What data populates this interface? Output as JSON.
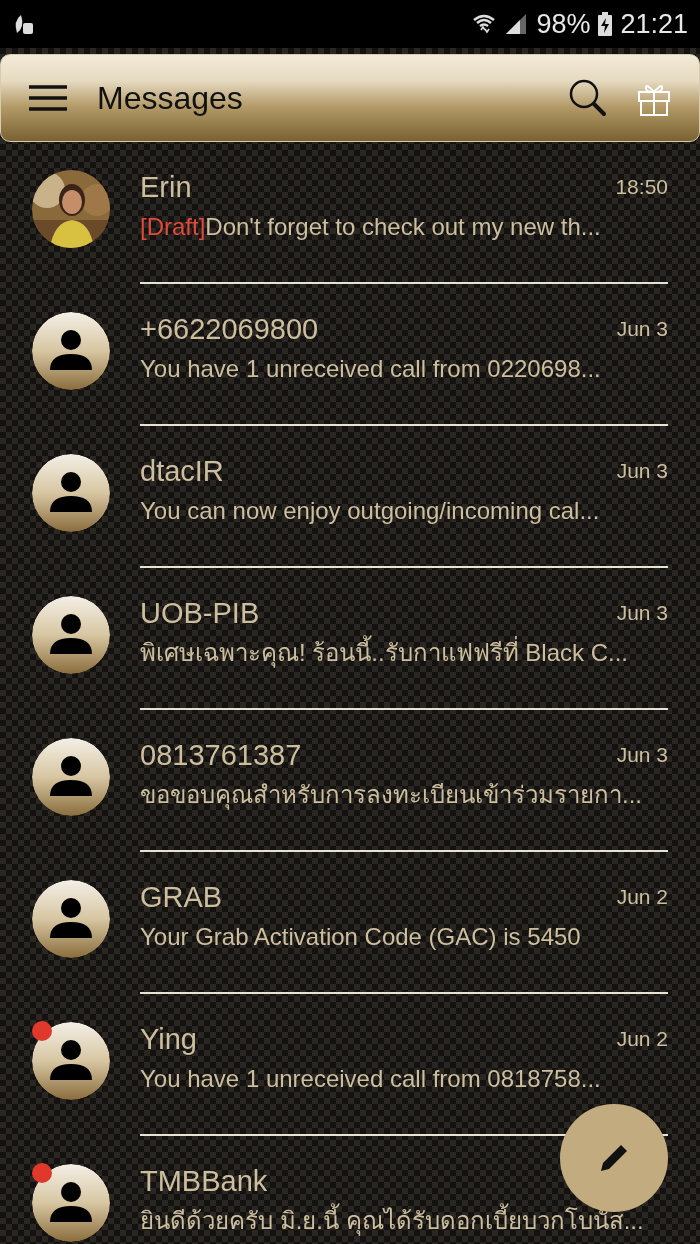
{
  "status_bar": {
    "battery": "98%",
    "time": "21:21"
  },
  "toolbar": {
    "title": "Messages"
  },
  "conversations": [
    {
      "name": "Erin",
      "date": "18:50",
      "draft_label": "[Draft]",
      "preview": "Don't forget to check out my new th...",
      "unread": false
    },
    {
      "name": "+6622069800",
      "date": "Jun 3",
      "preview": "You have 1 unreceived call from 0220698...",
      "kind": "contact",
      "unread": false
    },
    {
      "name": "dtacIR",
      "date": "Jun 3",
      "preview": "You can now enjoy outgoing/incoming cal...",
      "kind": "contact",
      "unread": false
    },
    {
      "name": "UOB-PIB",
      "date": "Jun 3",
      "preview": "พิเศษเฉพาะคุณ! ร้อนนี้..รับกาแฟฟรีที่ Black C...",
      "kind": "contact",
      "unread": false
    },
    {
      "name": "0813761387",
      "date": "Jun 3",
      "preview": "ขอขอบคุณสำหรับการลงทะเบียนเข้าร่วมรายกา...",
      "kind": "contact",
      "unread": false
    },
    {
      "name": "GRAB",
      "date": "Jun 2",
      "preview": "Your Grab Activation Code (GAC) is 5450",
      "kind": "contact",
      "unread": false
    },
    {
      "name": "Ying",
      "date": "Jun 2",
      "preview": "You have 1 unreceived call from 0818758...",
      "kind": "contact",
      "unread": true
    },
    {
      "name": "TMBBank",
      "preview": "ยินดีด้วยครับ มิ.ย.นี้ คุณได้รับดอกเบี้ยบวกโบนัส...",
      "kind": "contact",
      "unread": true
    }
  ]
}
